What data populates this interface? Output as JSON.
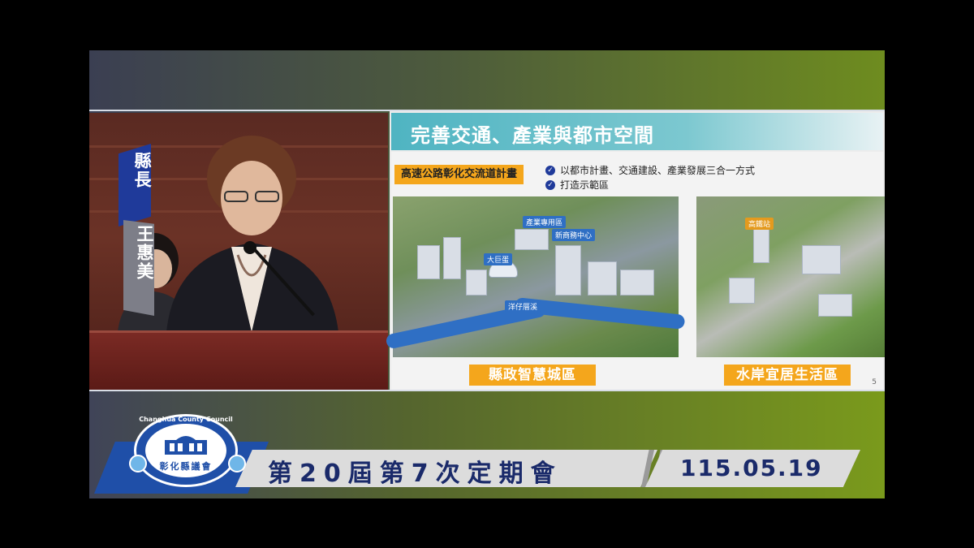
{
  "speaker": {
    "title_chars": "縣長",
    "name_chars": "王惠美"
  },
  "slide": {
    "title": "完善交通、產業與都市空間",
    "project": "高速公路彰化交流道計畫",
    "bullets": [
      "以都市計畫、交通建設、產業發展三合一方式",
      "打造示範區"
    ],
    "map1_labels": [
      "產業專用區",
      "新商務中心",
      "大巨蛋",
      "洋仔厝溪"
    ],
    "map2_labels": [
      "高鐵站"
    ],
    "caption_left": "縣政智慧城區",
    "caption_right": "水岸宜居生活區",
    "page_number": "5"
  },
  "banner": {
    "session": "第20屆第7次定期會",
    "date": "115.05.19",
    "logo_text": "Changhua County Council",
    "logo_name": "彰化縣議會"
  },
  "colors": {
    "accent_orange": "#f4a61c",
    "brand_blue": "#1f4fa8",
    "slide_header": "#4fb4c2"
  }
}
